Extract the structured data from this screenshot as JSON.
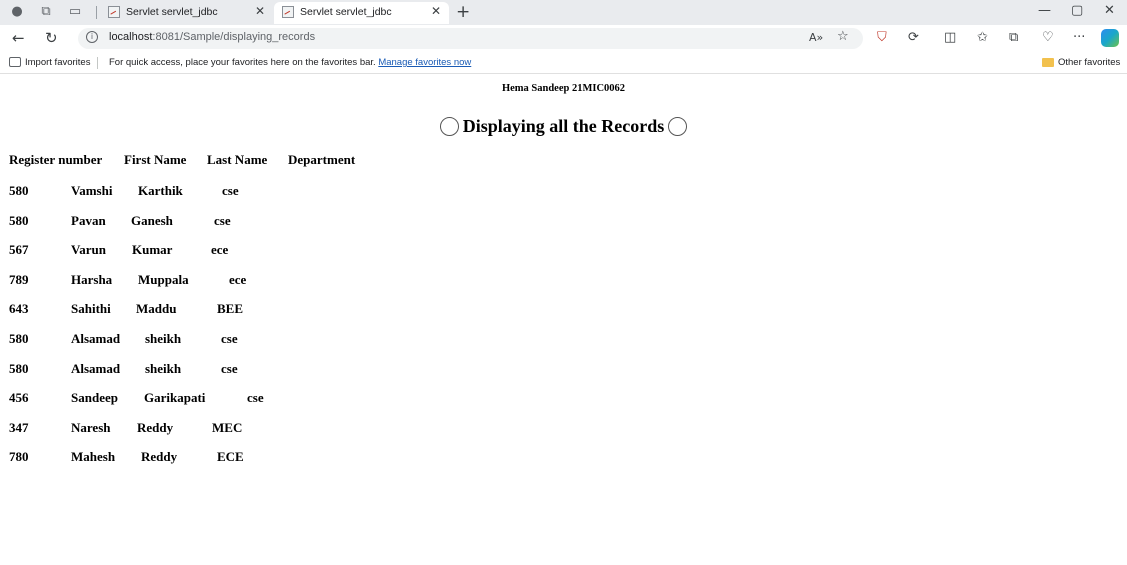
{
  "browser": {
    "tabs": [
      {
        "title": "Servlet servlet_jdbc",
        "active": false
      },
      {
        "title": "Servlet servlet_jdbc",
        "active": true
      }
    ],
    "url_host": "localhost",
    "url_rest": ":8081/Sample/displaying_records",
    "favorites_bar": {
      "import_label": "Import favorites",
      "hint": "For quick access, place your favorites here on the favorites bar.",
      "manage_link": "Manage favorites now",
      "other_label": "Other favorites"
    },
    "icons": {
      "profile": "profile-icon",
      "workspaces": "workspaces-icon",
      "tab_actions": "tab-actions-icon",
      "back": "back-icon",
      "refresh": "refresh-icon",
      "read_aloud": "read-aloud-icon",
      "favorite_star": "star-icon",
      "extensions": "extensions-icon",
      "split": "split-screen-icon",
      "favorites": "favorites-icon",
      "collections": "collections-icon",
      "more": "more-icon",
      "copilot": "copilot-icon"
    }
  },
  "page": {
    "author": "Hema Sandeep 21MIC0062",
    "title": "Displaying all the Records",
    "columns": [
      "Register number",
      "First Name",
      "Last Name",
      "Department"
    ],
    "rows": [
      [
        "580",
        "Vamshi",
        "Karthik",
        "cse"
      ],
      [
        "580",
        "Pavan",
        "Ganesh",
        "cse"
      ],
      [
        "567",
        "Varun",
        "Kumar",
        "ece"
      ],
      [
        "789",
        "Harsha",
        "Muppala",
        "ece"
      ],
      [
        "643",
        "Sahithi",
        "Maddu",
        "BEE"
      ],
      [
        "580",
        "Alsamad",
        "sheikh",
        "cse"
      ],
      [
        "580",
        "Alsamad",
        "sheikh",
        "cse"
      ],
      [
        "456",
        "Sandeep",
        "Garikapati",
        "cse"
      ],
      [
        "347",
        "Naresh",
        "Reddy",
        "MEC"
      ],
      [
        "780",
        "Mahesh",
        "Reddy",
        "ECE"
      ]
    ]
  }
}
